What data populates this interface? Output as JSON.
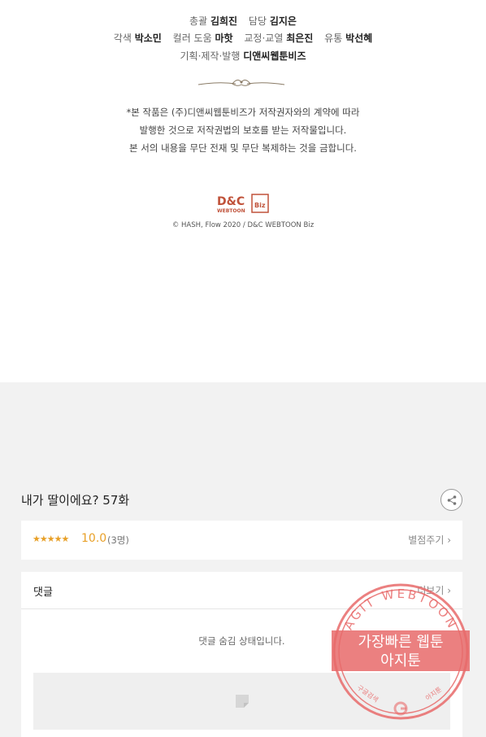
{
  "credits": [
    [
      {
        "role": "총괄",
        "name": "김희진"
      },
      {
        "role": "담당",
        "name": "김지은"
      }
    ],
    [
      {
        "role": "각색",
        "name": "박소민"
      },
      {
        "role": "컬러 도움",
        "name": "마핫"
      },
      {
        "role": "교정·교열",
        "name": "최은진"
      },
      {
        "role": "유통",
        "name": "박선혜"
      }
    ],
    [
      {
        "role": "기획·제작·발행",
        "name": "디앤씨웹툰비즈"
      }
    ]
  ],
  "notice": [
    "*본 작품은 (주)디앤씨웹툰비즈가 저작권자와의 계약에 따라",
    "발행한 것으로 저작권법의 보호를 받는 저작물입니다.",
    "본 서의 내용을 무단 전재 및 무단 복제하는 것을 금합니다."
  ],
  "logo": {
    "main": "D&C",
    "sub": "WEBTOON",
    "badge": "Biz"
  },
  "copyright": "© HASH, Flow 2020 / D&C WEBTOON Biz",
  "episode": {
    "title": "내가 딸이에요? 57화",
    "share_icon": "share-icon"
  },
  "rating": {
    "stars": "★★★★★",
    "score": "10.0",
    "count": "(3명)",
    "rate_link": "별점주기 ›"
  },
  "comments": {
    "title": "댓글",
    "more_link": "더보기 ›",
    "hidden_message": "댓글 숨김 상태입니다."
  },
  "watermark": {
    "top_text": "AGIT WEBTOON",
    "line1": "가장빠른 웹툰",
    "line2": "아지툰",
    "bottom_left": "구글검색",
    "bottom_right": "아지툰"
  },
  "colors": {
    "accent": "#e8a028",
    "watermark": "#e86a6a",
    "logo": "#c0523a",
    "background_gray": "#f2f2f2"
  }
}
